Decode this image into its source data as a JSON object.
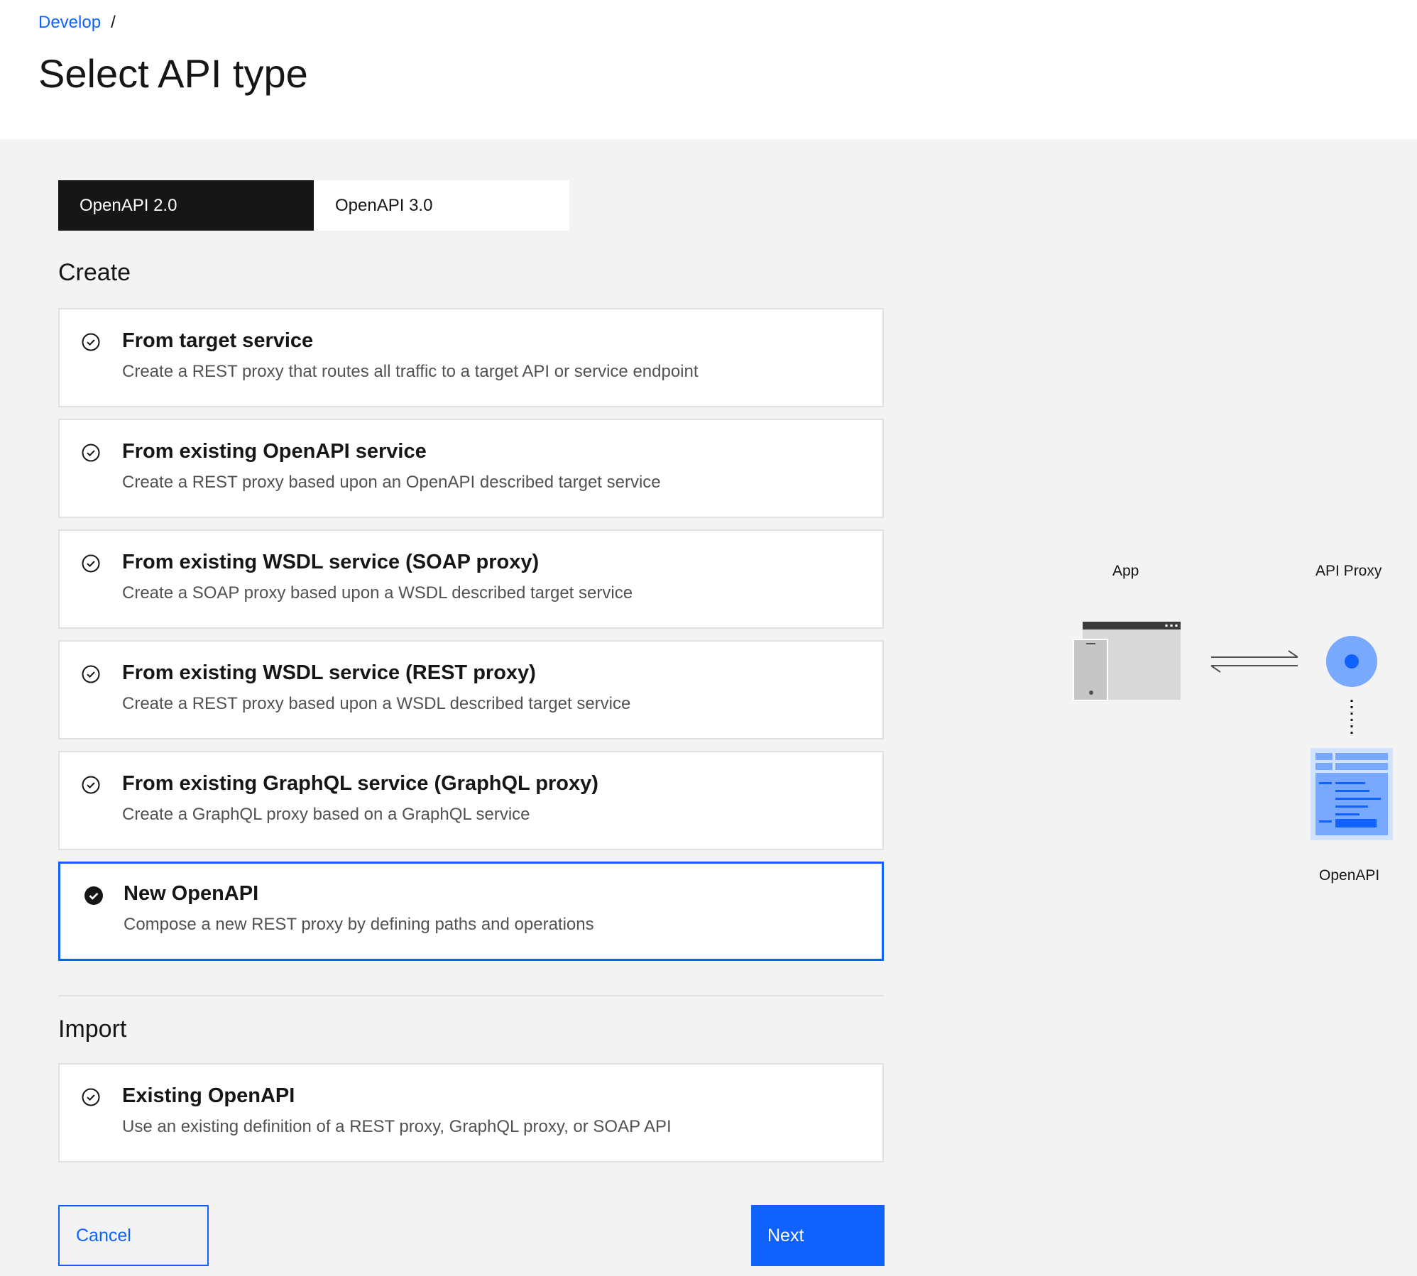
{
  "breadcrumb": {
    "link": "Develop",
    "separator": "/"
  },
  "page_title": "Select API type",
  "tabs": [
    {
      "label": "OpenAPI 2.0",
      "active": true
    },
    {
      "label": "OpenAPI 3.0",
      "active": false
    }
  ],
  "create": {
    "title": "Create",
    "options": [
      {
        "title": "From target service",
        "description": "Create a REST proxy that routes all traffic to a target API or service endpoint",
        "selected": false
      },
      {
        "title": "From existing OpenAPI service",
        "description": "Create a REST proxy based upon an OpenAPI described target service",
        "selected": false
      },
      {
        "title": "From existing WSDL service (SOAP proxy)",
        "description": "Create a SOAP proxy based upon a WSDL described target service",
        "selected": false
      },
      {
        "title": "From existing WSDL service (REST proxy)",
        "description": "Create a REST proxy based upon a WSDL described target service",
        "selected": false
      },
      {
        "title": "From existing GraphQL service (GraphQL proxy)",
        "description": "Create a GraphQL proxy based on a GraphQL service",
        "selected": false
      },
      {
        "title": "New OpenAPI",
        "description": "Compose a new REST proxy by defining paths and operations",
        "selected": true
      }
    ]
  },
  "import": {
    "title": "Import",
    "options": [
      {
        "title": "Existing OpenAPI",
        "description": "Use an existing definition of a REST proxy, GraphQL proxy, or SOAP API",
        "selected": false
      }
    ]
  },
  "buttons": {
    "cancel": "Cancel",
    "next": "Next"
  },
  "diagram": {
    "app_label": "App",
    "proxy_label": "API Proxy",
    "openapi_label": "OpenAPI"
  },
  "colors": {
    "primary": "#0f62fe",
    "tab_active_bg": "#161616",
    "page_bg": "#f3f3f3",
    "diagram_blue": "#4589ff",
    "diagram_light_blue": "#78a9ff"
  }
}
